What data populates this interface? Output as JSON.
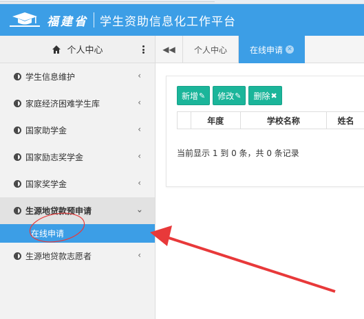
{
  "header": {
    "brand_script": "福建省",
    "title": "学生资助信息化工作平台"
  },
  "sidebar": {
    "head_title": "个人中心",
    "items": [
      {
        "label": "学生信息维护"
      },
      {
        "label": "家庭经济困难学生库"
      },
      {
        "label": "国家助学金"
      },
      {
        "label": "国家励志奖学金"
      },
      {
        "label": "国家奖学金"
      },
      {
        "label": "生源地贷款预申请"
      },
      {
        "label": "生源地贷款志愿者"
      }
    ],
    "sub_item": "在线申请"
  },
  "tabs": [
    {
      "label": "个人中心"
    },
    {
      "label": "在线申请"
    }
  ],
  "toolbar": {
    "add_label": "新增",
    "edit_label": "修改",
    "delete_label": "删除"
  },
  "table": {
    "columns": [
      "年度",
      "学校名称",
      "姓名"
    ]
  },
  "pager": {
    "text": "当前显示 1 到 0 条，共 0 条记录"
  },
  "colors": {
    "primary": "#3c9ee6",
    "button": "#1bb59a",
    "annotation": "#e8393a"
  }
}
